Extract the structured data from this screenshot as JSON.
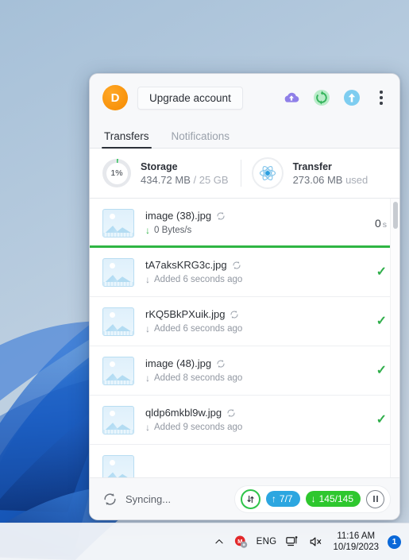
{
  "window": {
    "header": {
      "avatar_initial": "D",
      "upgrade_label": "Upgrade account",
      "icons": [
        "cloud-upload-icon",
        "sync-circle-icon",
        "upload-arrow-icon",
        "more-options-icon"
      ]
    },
    "tabs": [
      {
        "label": "Transfers",
        "active": true
      },
      {
        "label": "Notifications",
        "active": false
      }
    ],
    "quota": {
      "storage": {
        "percent_label": "1%",
        "title": "Storage",
        "used": "434.72 MB",
        "separator": " / ",
        "total": "25 GB"
      },
      "transfer": {
        "title": "Transfer",
        "used": "273.06 MB",
        "suffix": "used"
      }
    },
    "transfers": [
      {
        "filename": "image (38).jpg",
        "status": "0 Bytes/s",
        "right_value": "0",
        "right_unit": "s",
        "state": "active",
        "progress_percent": 97
      },
      {
        "filename": "tA7aksKRG3c.jpg",
        "status": "Added 6 seconds ago",
        "right_value": "✓",
        "state": "done"
      },
      {
        "filename": "rKQ5BkPXuik.jpg",
        "status": "Added 6 seconds ago",
        "right_value": "✓",
        "state": "done"
      },
      {
        "filename": "image (48).jpg",
        "status": "Added 8 seconds ago",
        "right_value": "✓",
        "state": "done"
      },
      {
        "filename": "qldp6mkbl9w.jpg",
        "status": "Added 9 seconds ago",
        "right_value": "✓",
        "state": "done"
      }
    ],
    "footer": {
      "sync_label": "Syncing...",
      "upload_count": "7/7",
      "download_count": "145/145",
      "pause_label": "pause-button"
    }
  },
  "taskbar": {
    "chevron": "∧",
    "language": "ENG",
    "time": "11:16 AM",
    "date": "10/19/2023",
    "notification_count": "1"
  },
  "colors": {
    "accent_orange": "#f58a00",
    "green": "#2fb643",
    "blue": "#2ca6e0",
    "purple": "#8f7fe8",
    "taskbar_badge": "#0a68d8"
  }
}
